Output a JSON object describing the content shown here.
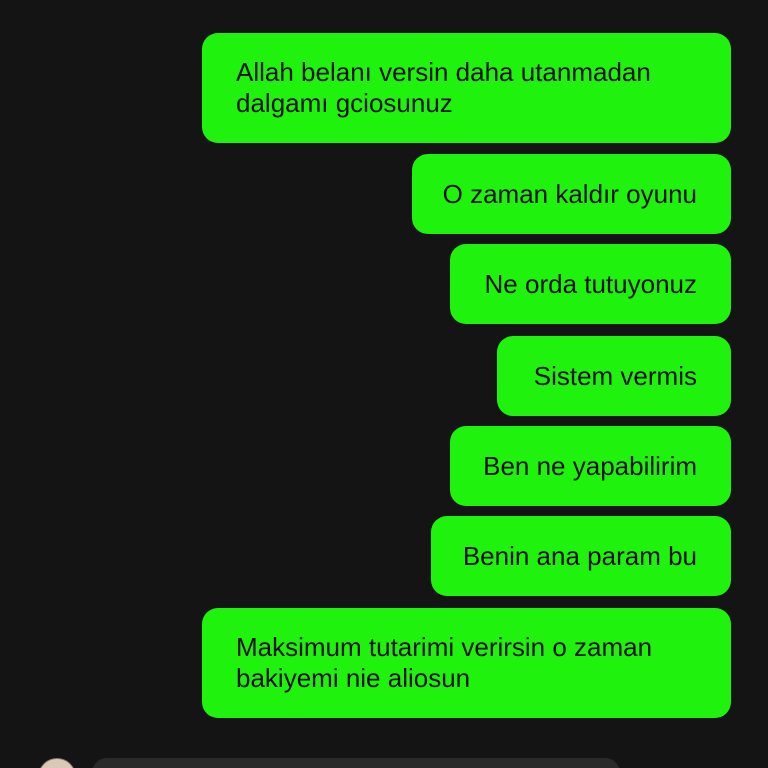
{
  "colors": {
    "background": "#141414",
    "bubble": "#1ff20c",
    "text": "#111111"
  },
  "messages": [
    {
      "lines": [
        "Allah belanı versin daha utanmadan",
        "dalgamı gciosunuz"
      ]
    },
    {
      "lines": [
        "O zaman kaldır oyunu"
      ]
    },
    {
      "lines": [
        "Ne orda tutuyonuz"
      ]
    },
    {
      "lines": [
        "Sistem vermis"
      ]
    },
    {
      "lines": [
        "Ben ne yapabilirim"
      ]
    },
    {
      "lines": [
        "Benin ana param bu"
      ]
    },
    {
      "lines": [
        "Maksimum tutarimi verirsin o zaman",
        "bakiyemi nie aliosun"
      ]
    }
  ]
}
